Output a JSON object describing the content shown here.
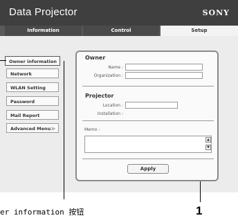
{
  "header": {
    "title": "Data Projector",
    "brand": "SONY"
  },
  "tabs": [
    "Information",
    "Control",
    "Setup"
  ],
  "sidebar": {
    "items": [
      {
        "label": "Owner information"
      },
      {
        "label": "Network"
      },
      {
        "label": "WLAN Setting"
      },
      {
        "label": "Password"
      },
      {
        "label": "Mail Report"
      },
      {
        "label": "Advanced Menu"
      }
    ],
    "advanced_chevron": "≫"
  },
  "owner": {
    "heading": "Owner",
    "name_label": "Name :",
    "organization_label": "Organization :"
  },
  "projector": {
    "heading": "Projector",
    "location_label": "Location :",
    "installation_label": "Installation :"
  },
  "memo": {
    "label": "Memo :",
    "up": "▲",
    "down": "▼"
  },
  "apply_label": "Apply",
  "callout": {
    "number": "1",
    "caption": "er information 按钮"
  }
}
